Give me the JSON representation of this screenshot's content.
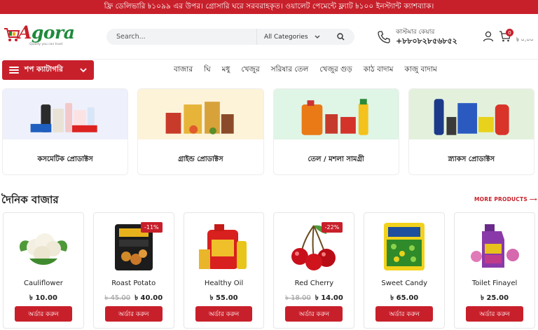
{
  "announcement": "ফ্রি ডেলিভারি ৳১০৯৯ এর উপর। গ্রোসারি ঘরে সরবরাহকৃত। ওয়ালেট পেমেন্টে ফ্ল্যাট ৳১০০ ইনস্ট্যান্ট ক্যাশব্যাক।",
  "brand": {
    "name_a": "A",
    "name_rest": "gora",
    "tagline": "Quality you can trust"
  },
  "search": {
    "placeholder": "Search...",
    "category": "All Categories"
  },
  "support": {
    "label": "কাস্টমার কেয়ার",
    "phone": "+৮৮০৮২৮৫৬৮৫২"
  },
  "cart": {
    "count": "0",
    "total": "৳ ০.০০"
  },
  "nav": {
    "shop_category": "শপ ক্যাটাগরি",
    "links": [
      "বাজার",
      "ঘি",
      "মধু",
      "খেজুর",
      "সরিষার তেল",
      "খেজুর গুড়",
      "কাঠ বাদাম",
      "কাজু বাদাম"
    ]
  },
  "categories": [
    {
      "label": "কসমেটিক প্রোডাক্টস",
      "bg": "#eef0fb"
    },
    {
      "label": "গ্রাইন্ড প্রোডাক্টস",
      "bg": "#fdf3d9"
    },
    {
      "label": "তেল / মশলা সামগ্রী",
      "bg": "#dff5e6"
    },
    {
      "label": "স্ন্যাকস প্রোডাক্টস",
      "bg": "#e3f1dc"
    }
  ],
  "section": {
    "title": "দৈনিক বাজার",
    "more": "MORE PRODUCTS ⟶"
  },
  "products": [
    {
      "name": "Cauliflower",
      "old_price": "",
      "price": "৳ 10.00",
      "discount": "",
      "button": "অর্ডার করুন"
    },
    {
      "name": "Roast Potato",
      "old_price": "৳ 45.00",
      "price": "৳ 40.00",
      "discount": "-11%",
      "button": "অর্ডার করুন"
    },
    {
      "name": "Healthy Oil",
      "old_price": "",
      "price": "৳ 55.00",
      "discount": "",
      "button": "অর্ডার করুন"
    },
    {
      "name": "Red Cherry",
      "old_price": "৳ 18.00",
      "price": "৳ 14.00",
      "discount": "-22%",
      "button": "অর্ডার করুন"
    },
    {
      "name": "Sweet Candy",
      "old_price": "",
      "price": "৳ 65.00",
      "discount": "",
      "button": "অর্ডার করুন"
    },
    {
      "name": "Toilet Finayel",
      "old_price": "",
      "price": "৳ 25.00",
      "discount": "",
      "button": "অর্ডার করুন"
    }
  ],
  "icons": {
    "search": "search-icon",
    "phone": "phone-icon",
    "user": "user-icon",
    "cart": "cart-icon",
    "menu": "menu-icon",
    "chevron": "chevron-down-icon"
  },
  "colors": {
    "accent": "#c8202b",
    "brand_green": "#1e8a3c"
  }
}
